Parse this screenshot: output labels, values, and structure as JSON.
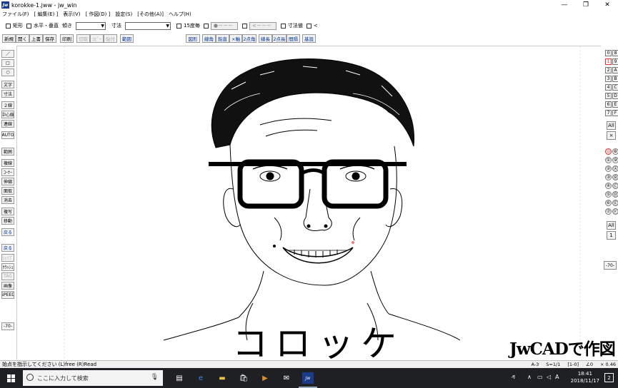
{
  "window": {
    "title": "korokke-1.jww - jw_win",
    "app_icon": "Jw",
    "controls": [
      "—",
      "❐",
      "✕"
    ]
  },
  "menu": [
    "ファイル(F)",
    "[ 編集(E) ]",
    "表示(V)",
    "[ 作図(D) ]",
    "設定(S)",
    "[その他(A)]",
    "ヘルプ(H)"
  ],
  "toolbar1": {
    "rect": "矩形",
    "hv": "水平・垂直",
    "slope": "傾き",
    "dim": "寸法",
    "deg15": "15度毎",
    "dim_value": "寸法値",
    "lt": "<",
    "g1": "●－－－",
    "g2": "<－－－"
  },
  "toolbar2": [
    "新規",
    "開く",
    "上書",
    "保存",
    "印刷",
    "切取",
    "ｺﾋﾟｰ",
    "貼付",
    "範囲",
    "図形",
    "線角",
    "鉛直",
    "×軸",
    "2点角",
    "線長",
    "2点長",
    "間隔",
    "基設"
  ],
  "leftbar": [
    "／",
    "□",
    "○",
    "文字",
    "寸法",
    "２線",
    "中心線",
    "連線",
    "AUTO",
    "範囲",
    "複線",
    "ｺｰﾅｰ",
    "伸縮",
    "面取",
    "消去",
    "複写",
    "移動",
    "戻る",
    "戻る",
    "ｼｪｲﾌﾟ",
    "ｸﾗｯｼｭ",
    "TAG",
    "画像",
    "SPEED",
    "-70-"
  ],
  "rightbar": {
    "layer_groups": [
      "0",
      "8",
      "1",
      "9",
      "2",
      "A",
      "3",
      "B",
      "4",
      "C",
      "5",
      "D",
      "6",
      "E",
      "7",
      "F"
    ],
    "all1": "All",
    "x": "×",
    "layers": [
      "⓪",
      "⑧",
      "①",
      "⑨",
      "②",
      "Ⓐ",
      "③",
      "Ⓑ",
      "④",
      "Ⓒ",
      "⑤",
      "Ⓓ",
      "⑥",
      "Ⓔ",
      "⑦",
      "Ⓕ"
    ],
    "all2": "All",
    "one": "1",
    "scale": "-70-"
  },
  "canvas": {
    "caption": "コロッケ",
    "watermark": "JwCADで作図"
  },
  "status": {
    "message": "始点を指示してください (L)free (R)Read",
    "paper": "A-3",
    "scale": "S=1/1",
    "layer": "[1-0]",
    "angle": "∠0",
    "factor": "× 0.46"
  },
  "taskbar": {
    "search_placeholder": "ここに入力して検索",
    "time": "18:41",
    "date": "2018/11/17",
    "notifications": "2",
    "ime": "A"
  }
}
